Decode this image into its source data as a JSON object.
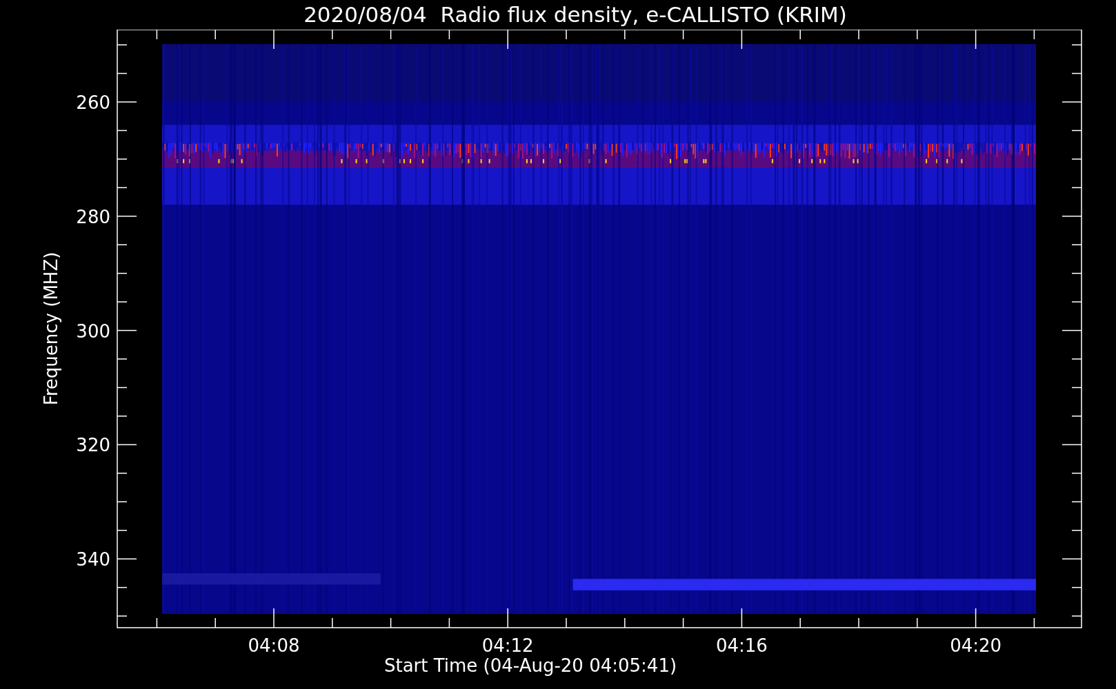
{
  "title": "2020/08/04  Radio flux density, e-CALLISTO (KRIM)",
  "plot": {
    "xlabel": "Start Time (04-Aug-20 04:05:41)",
    "ylabel": "Frequency (MHZ)",
    "yticks": [
      "260",
      "280",
      "300",
      "320",
      "340"
    ],
    "xticks": [
      "04:08",
      "04:12",
      "04:16",
      "04:20"
    ]
  }
}
